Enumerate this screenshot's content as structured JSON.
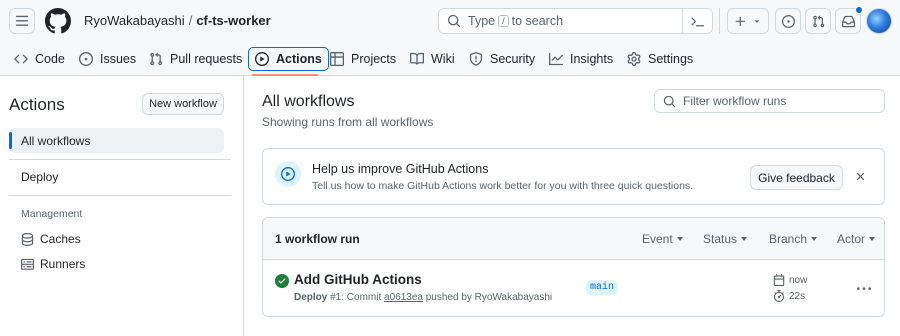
{
  "header": {
    "owner": "RyoWakabayashi",
    "separator": "/",
    "repo": "cf-ts-worker",
    "search_prefix": "Type",
    "search_key": "/",
    "search_suffix": "to search"
  },
  "tabs": [
    {
      "label": "Code"
    },
    {
      "label": "Issues"
    },
    {
      "label": "Pull requests"
    },
    {
      "label": "Actions"
    },
    {
      "label": "Projects"
    },
    {
      "label": "Wiki"
    },
    {
      "label": "Security"
    },
    {
      "label": "Insights"
    },
    {
      "label": "Settings"
    }
  ],
  "sidebar": {
    "title": "Actions",
    "new_workflow": "New workflow",
    "all_workflows": "All workflows",
    "workflows": [
      "Deploy"
    ],
    "management_heading": "Management",
    "management_items": [
      "Caches",
      "Runners"
    ]
  },
  "main": {
    "title": "All workflows",
    "subtitle": "Showing runs from all workflows",
    "filter_placeholder": "Filter workflow runs"
  },
  "banner": {
    "title": "Help us improve GitHub Actions",
    "text": "Tell us how to make GitHub Actions work better for you with three quick questions.",
    "button": "Give feedback"
  },
  "runs": {
    "count": "1 workflow run",
    "filters": [
      "Event",
      "Status",
      "Branch",
      "Actor"
    ],
    "items": [
      {
        "title": "Add GitHub Actions",
        "workflow": "Deploy",
        "run_number": "#1: Commit",
        "commit": "a0613ea",
        "pushed_by": "pushed by RyoWakabayashi",
        "branch": "main",
        "time": "now",
        "duration": "22s"
      }
    ]
  },
  "colors": {
    "accent": "#0969da",
    "success": "#1a7f37",
    "tab_underline": "#fd8c73"
  }
}
